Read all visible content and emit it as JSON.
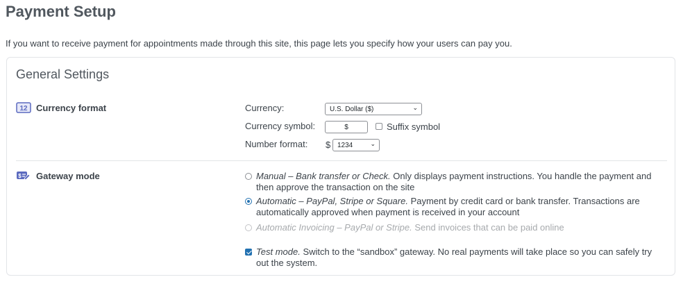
{
  "page": {
    "title": "Payment Setup",
    "intro": "If you want to receive payment for appointments made through this site, this page lets you specify how your users can pay you."
  },
  "general": {
    "title": "General Settings",
    "currency_format": {
      "heading": "Currency format",
      "icon": "calendar-12-icon",
      "currency_label": "Currency:",
      "currency_value": "U.S. Dollar ($)",
      "symbol_label": "Currency symbol:",
      "symbol_value": "$",
      "suffix_label": "Suffix symbol",
      "suffix_checked": false,
      "number_label": "Number format:",
      "number_prefix": "$",
      "number_value": "1234"
    },
    "gateway_mode": {
      "heading": "Gateway mode",
      "icon": "payment-gateway-icon",
      "options": [
        {
          "name": "Manual – Bank transfer or Check.",
          "desc": "Only displays payment instructions. You handle the payment and then approve the transaction on the site",
          "selected": false,
          "disabled": false
        },
        {
          "name": "Automatic – PayPal, Stripe or Square.",
          "desc": "Payment by credit card or bank transfer. Transactions are automatically approved when payment is received in your account",
          "selected": true,
          "disabled": false
        },
        {
          "name": "Automatic Invoicing – PayPal or Stripe.",
          "desc": "Send invoices that can be paid online",
          "selected": false,
          "disabled": true
        }
      ],
      "test_mode": {
        "name": "Test mode.",
        "desc": "Switch to the “sandbox” gateway. No real payments will take place so you can safely try out the system.",
        "checked": true
      }
    }
  },
  "colors": {
    "accent": "#2271b1",
    "icon": "#5b6abf",
    "heading": "#50575e",
    "border": "#e2e4e7"
  }
}
